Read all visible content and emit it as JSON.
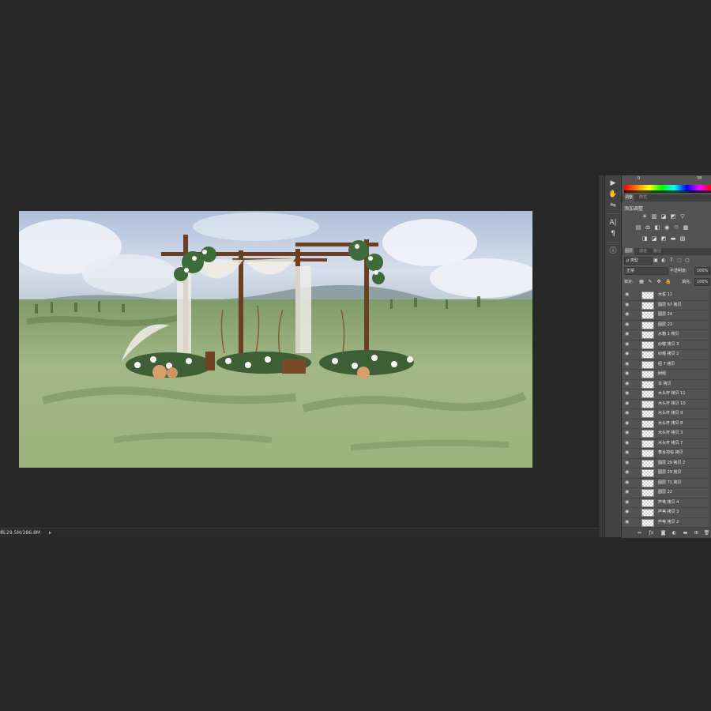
{
  "status_bar": {
    "doc_info": "档:29.5M/286.8M",
    "arrow": "▸"
  },
  "color_panel": {
    "value_left": "0",
    "value_right": "38"
  },
  "adjust_panel": {
    "tabs": [
      {
        "label": "调整"
      },
      {
        "label": "样式"
      }
    ],
    "title": "添加调整"
  },
  "layers_panel": {
    "tabs": [
      {
        "label": "图层"
      },
      {
        "label": "通道"
      },
      {
        "label": "路径"
      }
    ],
    "filter_kind": "ρ 类型",
    "blend_mode": "正常",
    "opacity_label": "不透明度:",
    "opacity_value": "100%",
    "lock_label": "锁定:",
    "fill_label": "填充:",
    "fill_value": "100%",
    "layers": [
      {
        "name": "木桩 11"
      },
      {
        "name": "图层 67 拷贝"
      },
      {
        "name": "图层 24"
      },
      {
        "name": "图层 23"
      },
      {
        "name": "水箱 1 拷贝"
      },
      {
        "name": "纱幔 拷贝 3"
      },
      {
        "name": "纱幔 拷贝 2"
      },
      {
        "name": "组 7 拷贝"
      },
      {
        "name": "树组"
      },
      {
        "name": "伞 拷贝"
      },
      {
        "name": "木头杆 拷贝 11"
      },
      {
        "name": "木头杆 拷贝 10"
      },
      {
        "name": "木头杆 拷贝 9"
      },
      {
        "name": "木头杆 拷贝 8"
      },
      {
        "name": "木头杆 拷贝 3"
      },
      {
        "name": "木头杆 拷贝 7"
      },
      {
        "name": "舞台地毯 拷贝"
      },
      {
        "name": "图层 29 拷贝 2"
      },
      {
        "name": "图层 29 拷贝"
      },
      {
        "name": "图层 71 拷贝"
      },
      {
        "name": "图层 22"
      },
      {
        "name": "芦苇 拷贝 4"
      },
      {
        "name": "芦苇 拷贝 3"
      },
      {
        "name": "芦苇 拷贝 2"
      }
    ]
  },
  "colors": {
    "panel_bg": "#535353",
    "workspace_bg": "#282828",
    "grass": "#8da576",
    "sky": "#c9d6e8"
  }
}
